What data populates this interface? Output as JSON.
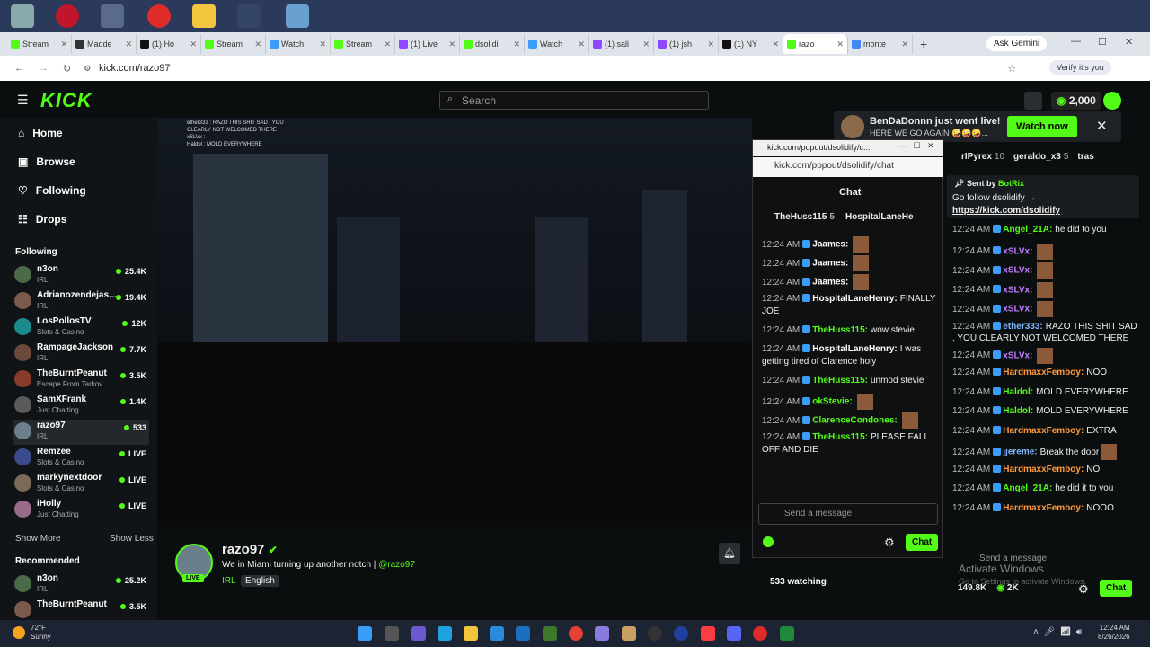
{
  "browser": {
    "tabs": [
      "Stream",
      "Madde",
      "(1) Ho",
      "Stream",
      "Watch",
      "Stream",
      "(1) Live",
      "dsolidi",
      "Watch",
      "(1) sali",
      "(1) jsh",
      "(1) NY",
      "razo",
      "monte"
    ],
    "active_tab_index": 12,
    "gemini_label": "Ask Gemini",
    "url": "kick.com/razo97",
    "verify_label": "Verify it's you"
  },
  "kick": {
    "logo": "KICK",
    "search_placeholder": "Search",
    "balance": "2,000",
    "nav": [
      "Home",
      "Browse",
      "Following",
      "Drops"
    ],
    "following_header": "Following",
    "following": [
      {
        "name": "n3on",
        "cat": "IRL",
        "viewers": "25.4K"
      },
      {
        "name": "Adrianozendejas...",
        "cat": "IRL",
        "viewers": "19.4K"
      },
      {
        "name": "LosPollosTV",
        "cat": "Slots & Casino",
        "viewers": "12K"
      },
      {
        "name": "RampageJackson",
        "cat": "IRL",
        "viewers": "7.7K"
      },
      {
        "name": "TheBurntPeanut",
        "cat": "Escape From Tarkov",
        "viewers": "3.5K"
      },
      {
        "name": "SamXFrank",
        "cat": "Just Chatting",
        "viewers": "1.4K"
      },
      {
        "name": "razo97",
        "cat": "IRL",
        "viewers": "533"
      },
      {
        "name": "Remzee",
        "cat": "Slots & Casino",
        "viewers": "LIVE"
      },
      {
        "name": "markynextdoor",
        "cat": "Slots & Casino",
        "viewers": "LIVE"
      },
      {
        "name": "iHolly",
        "cat": "Just Chatting",
        "viewers": "LIVE"
      }
    ],
    "show_more": "Show More",
    "show_less": "Show Less",
    "recommended_header": "Recommended",
    "recommended": [
      {
        "name": "n3on",
        "cat": "IRL",
        "viewers": "25.2K"
      },
      {
        "name": "TheBurntPeanut",
        "cat": "",
        "viewers": "3.5K"
      }
    ],
    "video_overlay": [
      "ether333 : RAZO THIS SHIT SAD , YOU",
      "CLEARLY NOT WELCOMED THERE",
      "xSLVx :",
      "Haldol : MOLD EVERYWHERE"
    ],
    "channel": {
      "name": "razo97",
      "title": "We in Miami turning up another notch |",
      "handle": "@razo97",
      "category": "IRL",
      "language": "English",
      "live": "LIVE",
      "watching": "533 watching"
    },
    "notification": {
      "user": "BenDaDonnn",
      "text": "just went live!",
      "sub": "HERE WE GO AGAIN 🤪🤪🤪...",
      "button": "Watch now"
    }
  },
  "popout": {
    "title": "kick.com/popout/dsolidify/c...",
    "url": "kick.com/popout/dsolidify/chat",
    "header": "Chat",
    "top_gifters": [
      {
        "name": "TheHuss115",
        "n": "5"
      },
      {
        "name": "HospitalLaneHe",
        "n": ""
      }
    ],
    "messages": [
      {
        "t": "12:24 AM",
        "u": "Jaames:",
        "c": "u5",
        "m": "",
        "emo": true
      },
      {
        "t": "12:24 AM",
        "u": "Jaames:",
        "c": "u5",
        "m": "",
        "emo": true
      },
      {
        "t": "12:24 AM",
        "u": "Jaames:",
        "c": "u5",
        "m": "",
        "emo": true
      },
      {
        "t": "12:24 AM",
        "u": "HospitalLaneHenry:",
        "c": "u5",
        "m": "FINALLY JOE"
      },
      {
        "t": "12:24 AM",
        "u": "TheHuss115:",
        "c": "u1",
        "m": "wow stevie"
      },
      {
        "t": "12:24 AM",
        "u": "HospitalLaneHenry:",
        "c": "u5",
        "m": "I was getting tired of Clarence holy"
      },
      {
        "t": "12:24 AM",
        "u": "TheHuss115:",
        "c": "u1",
        "m": "unmod stevie"
      },
      {
        "t": "12:24 AM",
        "u": "okStevie:",
        "c": "u1",
        "m": "",
        "emo": true
      },
      {
        "t": "12:24 AM",
        "u": "ClarenceCondones:",
        "c": "u1",
        "m": "",
        "emo": true
      },
      {
        "t": "12:24 AM",
        "u": "TheHuss115:",
        "c": "u1",
        "m": "PLEASE FALL OFF AND DIE"
      }
    ],
    "input_placeholder": "Send a message",
    "chat_button": "Chat"
  },
  "right_chat": {
    "top": [
      {
        "name": "rIPyrex",
        "n": "10"
      },
      {
        "name": "geraldo_x3",
        "n": "5"
      },
      {
        "name": "tras",
        "n": ""
      }
    ],
    "pinned_by": "Sent by",
    "pinned_user": "BotRix",
    "pinned_text": "Go follow dsolidify →",
    "pinned_link": "https://kick.com/dsolidify",
    "messages": [
      {
        "t": "12:24 AM",
        "u": "Angel_21A:",
        "c": "u1",
        "m": "he did to you"
      },
      {
        "t": "12:24 AM",
        "u": "xSLVx:",
        "c": "u2",
        "m": "",
        "emo": true
      },
      {
        "t": "12:24 AM",
        "u": "xSLVx:",
        "c": "u2",
        "m": "",
        "emo": true
      },
      {
        "t": "12:24 AM",
        "u": "xSLVx:",
        "c": "u2",
        "m": "",
        "emo": true
      },
      {
        "t": "12:24 AM",
        "u": "xSLVx:",
        "c": "u2",
        "m": "",
        "emo": true
      },
      {
        "t": "12:24 AM",
        "u": "ether333:",
        "c": "u4",
        "m": "RAZO THIS SHIT SAD , YOU CLEARLY NOT WELCOMED THERE"
      },
      {
        "t": "12:24 AM",
        "u": "xSLVx:",
        "c": "u2",
        "m": "",
        "emo": true
      },
      {
        "t": "12:24 AM",
        "u": "HardmaxxFemboy:",
        "c": "u3",
        "m": "NOO"
      },
      {
        "t": "12:24 AM",
        "u": "Haldol:",
        "c": "u1",
        "m": "MOLD EVERYWHERE"
      },
      {
        "t": "12:24 AM",
        "u": "Haldol:",
        "c": "u1",
        "m": "MOLD EVERYWHERE"
      },
      {
        "t": "12:24 AM",
        "u": "HardmaxxFemboy:",
        "c": "u3",
        "m": "EXTRA"
      },
      {
        "t": "12:24 AM",
        "u": "jjereme:",
        "c": "u4",
        "m": "Break the door",
        "emo": true
      },
      {
        "t": "12:24 AM",
        "u": "HardmaxxFemboy:",
        "c": "u3",
        "m": "NO"
      },
      {
        "t": "12:24 AM",
        "u": "Angel_21A:",
        "c": "u1",
        "m": "he did it to you"
      },
      {
        "t": "12:24 AM",
        "u": "HardmaxxFemboy:",
        "c": "u3",
        "m": "NOOO"
      }
    ],
    "input_placeholder": "Send a message",
    "followers": "149.8K",
    "subs": "2K",
    "chat_button": "Chat",
    "activate": "Activate Windows",
    "activate_sub": "Go to Settings to activate Windows."
  },
  "taskbar": {
    "temp": "72°F",
    "weather": "Sunny",
    "time": "12:24 AM",
    "date": "8/26/2026"
  },
  "colors": {
    "kick_green": "#53fc18",
    "bg": "#0b0e0f"
  }
}
